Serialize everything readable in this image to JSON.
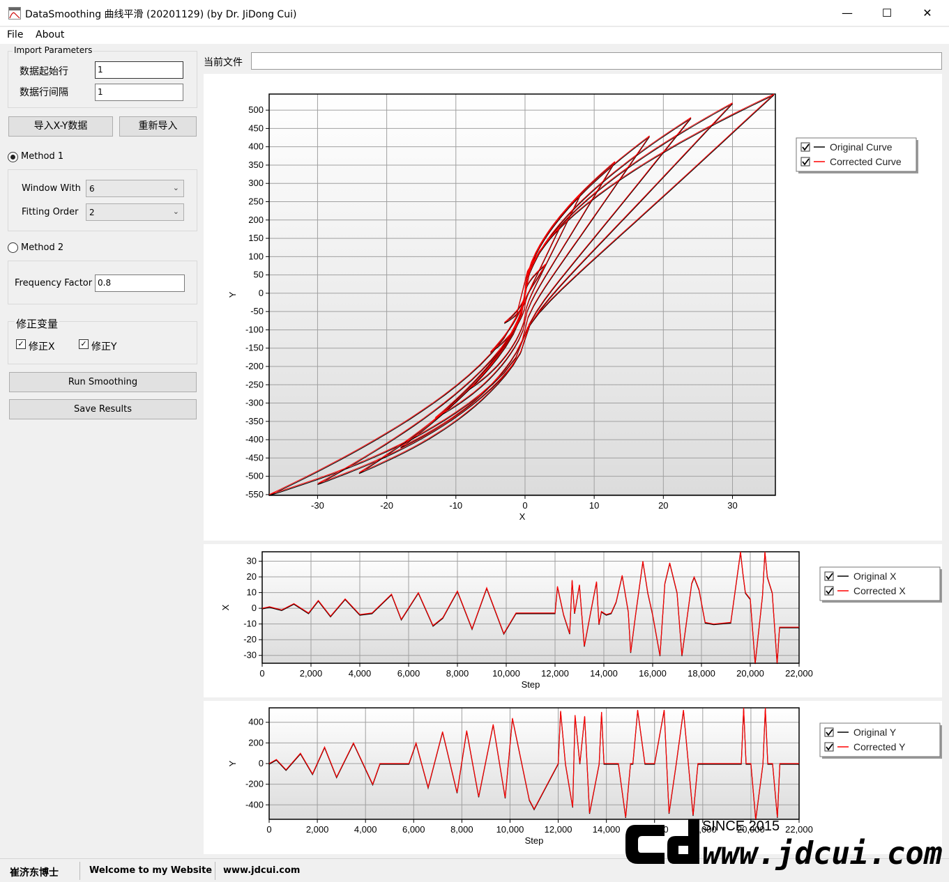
{
  "window": {
    "title": "DataSmoothing 曲线平滑 (20201129) (by Dr. JiDong Cui)",
    "minimize_glyph": "—",
    "maximize_glyph": "☐",
    "close_glyph": "✕"
  },
  "menu": [
    {
      "label": "File"
    },
    {
      "label": "About"
    }
  ],
  "import_params": {
    "title": "Import Parameters",
    "start_row_label": "数据起始行",
    "start_row_value": "1",
    "row_interval_label": "数据行间隔",
    "row_interval_value": "1"
  },
  "buttons": {
    "import_xy": "导入X-Y数据",
    "reimport": "重新导入",
    "run": "Run Smoothing",
    "save": "Save Results"
  },
  "method1": {
    "label": "Method 1",
    "selected": true,
    "window_label": "Window With",
    "window_value": "6",
    "order_label": "Fitting Order",
    "order_value": "2"
  },
  "method2": {
    "label": "Method 2",
    "selected": false,
    "freq_label": "Frequency Factor",
    "freq_value": "0.8"
  },
  "correct_vars": {
    "title": "修正变量",
    "x_label": "修正X",
    "x_checked": true,
    "y_label": "修正Y",
    "y_checked": true
  },
  "current_file": {
    "label": "当前文件",
    "value": ""
  },
  "status": {
    "item1": "崔济东博士",
    "item2": "Welcome to my Website",
    "item3": "www.jdcui.com"
  },
  "watermark": {
    "since": "SINCE 2015",
    "url": "www.jdcui.com"
  },
  "colors": {
    "original": "#000000",
    "corrected": "#ff0000",
    "grid": "#a0a0a0"
  },
  "chart_data": [
    {
      "type": "scatter",
      "xlabel": "X",
      "ylabel": "Y",
      "xlim": [
        -37,
        36.2
      ],
      "ylim": [
        -552,
        544
      ],
      "xticks": [
        -30,
        -20,
        -10,
        0,
        10,
        20,
        30
      ],
      "yticks": [
        500,
        450,
        400,
        350,
        300,
        250,
        200,
        150,
        100,
        50,
        0,
        -50,
        -100,
        -150,
        -200,
        -250,
        -300,
        -350,
        -400,
        -450,
        -500,
        -550
      ],
      "legend": {
        "placement": "right",
        "items": [
          "Original Curve",
          "Corrected Curve"
        ]
      },
      "series": [
        {
          "name": "Original Curve",
          "color": "#000000"
        },
        {
          "name": "Corrected Curve",
          "color": "#ff0000"
        }
      ],
      "loops": [
        {
          "xmax": 3,
          "ymax": 80,
          "xmin": -3,
          "ymin": -80
        },
        {
          "xmax": 5,
          "ymax": 180,
          "xmin": -5,
          "ymin": -160
        },
        {
          "xmax": 8,
          "ymax": 270,
          "xmin": -8,
          "ymin": -260
        },
        {
          "xmax": 13,
          "ymax": 360,
          "xmin": -13,
          "ymin": -340
        },
        {
          "xmax": 18,
          "ymax": 430,
          "xmin": -18,
          "ymin": -420
        },
        {
          "xmax": 24,
          "ymax": 480,
          "xmin": -24,
          "ymin": -490
        },
        {
          "xmax": 30,
          "ymax": 520,
          "xmin": -30,
          "ymin": -520
        },
        {
          "xmax": 36,
          "ymax": 544,
          "xmin": -37,
          "ymin": -550
        }
      ]
    },
    {
      "type": "line",
      "xlabel": "Step",
      "ylabel": "X",
      "xlim": [
        0,
        22000
      ],
      "ylim": [
        -35,
        36
      ],
      "xticks": [
        0,
        2000,
        4000,
        6000,
        8000,
        10000,
        12000,
        14000,
        16000,
        18000,
        20000,
        22000
      ],
      "xtick_labels": [
        "0",
        "2,000",
        "4,000",
        "6,000",
        "8,000",
        "10,000",
        "12,000",
        "14,000",
        "16,000",
        "18,000",
        "20,000",
        "22,000"
      ],
      "yticks": [
        30,
        20,
        10,
        0,
        -10,
        -20,
        -30
      ],
      "legend": {
        "placement": "right",
        "items": [
          "Original X",
          "Corrected X"
        ]
      },
      "series": [
        {
          "name": "Original X",
          "color": "#000000"
        },
        {
          "name": "Corrected X",
          "color": "#ff0000"
        }
      ],
      "x": [
        0,
        300,
        800,
        1300,
        1900,
        2300,
        2800,
        3400,
        4000,
        4500,
        5300,
        5700,
        6400,
        7000,
        7400,
        8000,
        8600,
        9200,
        9900,
        10400,
        10900,
        11400,
        12000,
        12100,
        12350,
        12600,
        12700,
        12800,
        13000,
        13200,
        13450,
        13700,
        13800,
        13900,
        14100,
        14300,
        14500,
        14750,
        15000,
        15100,
        15300,
        15600,
        15800,
        16000,
        16300,
        16500,
        16700,
        17000,
        17200,
        17600,
        17700,
        17900,
        18150,
        18500,
        19200,
        19600,
        19700,
        19800,
        20000,
        20200,
        20500,
        20600,
        20700,
        20900,
        21100,
        21200,
        21400,
        22000
      ],
      "values": [
        0,
        1,
        -1,
        3,
        -3,
        5,
        -5,
        6,
        -4,
        -3,
        9,
        -7,
        10,
        -11,
        -6,
        11,
        -13,
        13,
        -16,
        -3,
        -3,
        -3,
        -3,
        14,
        -4,
        -16,
        18,
        -3,
        15,
        -24,
        -3,
        17,
        -10,
        -2,
        -4,
        -3,
        4,
        21,
        -2,
        -28,
        -4,
        30,
        10,
        -4,
        -30,
        16,
        29,
        10,
        -30,
        16,
        20,
        12,
        -9,
        -10,
        -9,
        36,
        22,
        10,
        6,
        -35,
        8,
        36,
        20,
        10,
        -35,
        -12,
        -12,
        -12
      ]
    },
    {
      "type": "line",
      "xlabel": "Step",
      "ylabel": "Y",
      "xlim": [
        0,
        22000
      ],
      "ylim": [
        -540,
        540
      ],
      "xticks": [
        0,
        2000,
        4000,
        6000,
        8000,
        10000,
        12000,
        14000,
        16000,
        18000,
        20000,
        22000
      ],
      "xtick_labels": [
        "0",
        "2,000",
        "4,000",
        "6,000",
        "8,000",
        "10,000",
        "12,000",
        "14,000",
        "16,000",
        "18,000",
        "20,000",
        "22,000"
      ],
      "yticks": [
        400,
        200,
        0,
        -200,
        -400
      ],
      "legend": {
        "placement": "right",
        "items": [
          "Original Y",
          "Corrected Y"
        ]
      },
      "series": [
        {
          "name": "Original Y",
          "color": "#000000"
        },
        {
          "name": "Corrected Y",
          "color": "#ff0000"
        }
      ],
      "x": [
        0,
        300,
        700,
        1300,
        1800,
        2300,
        2800,
        3500,
        4300,
        4600,
        5800,
        6100,
        6600,
        7200,
        7800,
        8200,
        8700,
        9300,
        9800,
        10100,
        10800,
        11000,
        12000,
        12100,
        12300,
        12600,
        12700,
        12900,
        13100,
        13300,
        13700,
        13800,
        13900,
        14200,
        14500,
        14800,
        15000,
        15100,
        15300,
        15600,
        15800,
        16000,
        16400,
        16600,
        16900,
        17200,
        17600,
        17800,
        18000,
        18500,
        19600,
        19700,
        19800,
        20000,
        20200,
        20500,
        20600,
        20700,
        20900,
        21100,
        21200,
        21400,
        22000
      ],
      "values": [
        0,
        40,
        -60,
        100,
        -100,
        160,
        -130,
        200,
        -200,
        0,
        0,
        200,
        -230,
        310,
        -280,
        320,
        -320,
        380,
        -330,
        440,
        -350,
        -440,
        0,
        510,
        0,
        -420,
        470,
        0,
        460,
        -480,
        0,
        500,
        0,
        0,
        0,
        -520,
        0,
        0,
        520,
        0,
        0,
        0,
        520,
        -480,
        0,
        520,
        -500,
        0,
        0,
        0,
        0,
        540,
        0,
        0,
        -540,
        0,
        540,
        0,
        0,
        -520,
        0,
        0,
        0
      ]
    }
  ]
}
